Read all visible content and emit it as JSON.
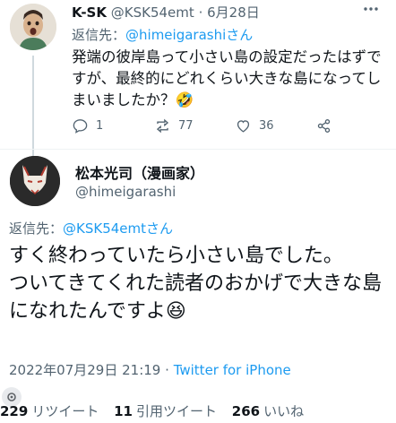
{
  "reply_tweet": {
    "display_name": "K-SK",
    "handle": "@KSK54emt",
    "separator": "·",
    "date": "6月28日",
    "replying_label": "返信先：",
    "replying_to": "@himeigarashiさん",
    "text": "発端の彼岸島って小さい島の設定だったはずですが、最終的にどれくらい大きな島になってしまいましたか？🤣",
    "more_icon": "more-icon",
    "actions": {
      "replies": "1",
      "retweets": "77",
      "likes": "36"
    }
  },
  "main_tweet": {
    "display_name": "松本光司（漫画家）",
    "handle": "@himeigarashi",
    "replying_label": "返信先：",
    "replying_to": "@KSK54emtさん",
    "paragraph_1": "すく終わっていたら小さい島でした。",
    "paragraph_2": "ついてきてくれた読者のおかげで大きな島になれたんですよ😆",
    "timestamp": "2022年07月29日 21:19",
    "meta_separator": "·",
    "client": "Twitter for iPhone"
  },
  "stats": {
    "retweets_count": "229",
    "retweets_label": "リツイート",
    "quotes_count": "11",
    "quotes_label": "引用ツイート",
    "likes_count": "266",
    "likes_label": "いいね"
  },
  "colors": {
    "link": "#1d9bf0",
    "secondary_text": "#536471",
    "primary_text": "#0f1419"
  }
}
